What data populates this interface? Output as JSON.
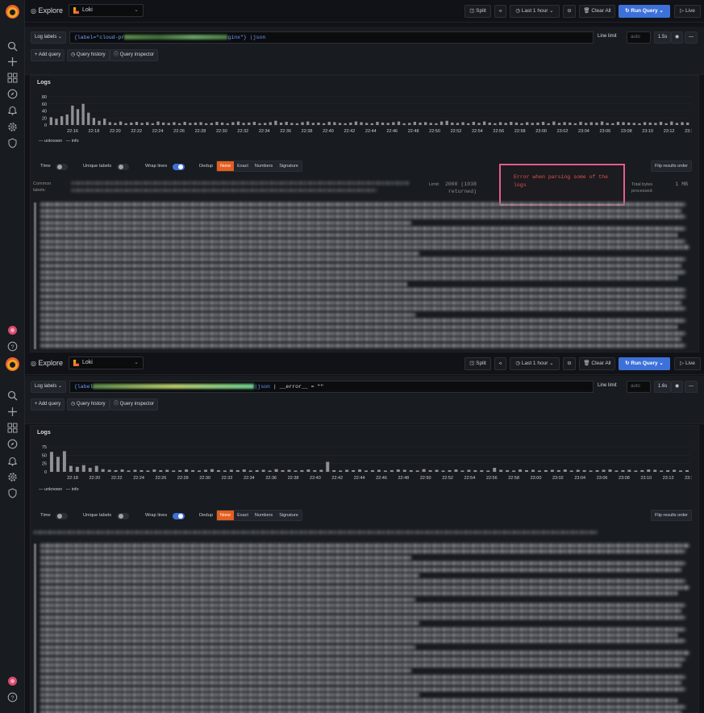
{
  "colors": {
    "accent": "#3d71d9",
    "error": "#e5534b",
    "highlight": "#e65c8d",
    "active": "#e65e1f",
    "bars": "#8e9095"
  },
  "sidebar": {
    "icons": [
      "grafana-logo-icon",
      "search-icon",
      "plus-icon",
      "dashboards-icon",
      "compass-icon",
      "bell-icon",
      "gear-icon",
      "shield-icon",
      "user-avatar-icon",
      "help-icon"
    ]
  },
  "header": {
    "title": "Explore",
    "datasource": "Loki",
    "split": "Split",
    "share_icon": "share-icon",
    "time_range": "Last 1 hour",
    "zoom_icon": "zoom-out-icon",
    "clear_all": "Clear All",
    "run_query": "Run Query",
    "live": "Live"
  },
  "query_row": {
    "log_labels": "Log labels",
    "line_limit": "Line limit",
    "line_limit_placeholder": "auto",
    "add_query": "Add query",
    "query_history": "Query history",
    "query_inspector": "Query inspector"
  },
  "screen1": {
    "query_pre": "{label=\"cloud-pr",
    "query_post": "ginx\"} ",
    "query_json": "|json",
    "duration": "1.5s",
    "panel_title": "Logs",
    "chart_data": {
      "type": "bar",
      "ylim": [
        0,
        80
      ],
      "yticks": [
        "80",
        "60",
        "40",
        "20",
        "0"
      ],
      "xticks": [
        "22:16",
        "22:18",
        "22:20",
        "22:22",
        "22:24",
        "22:26",
        "22:28",
        "22:30",
        "22:32",
        "22:34",
        "22:36",
        "22:38",
        "22:40",
        "22:42",
        "22:44",
        "22:46",
        "22:48",
        "22:50",
        "22:52",
        "22:54",
        "22:56",
        "22:58",
        "23:00",
        "23:02",
        "23:04",
        "23:06",
        "23:08",
        "23:10",
        "23:12",
        "23:14"
      ],
      "values": [
        22,
        18,
        25,
        30,
        55,
        45,
        60,
        35,
        20,
        12,
        18,
        8,
        6,
        10,
        5,
        7,
        9,
        6,
        8,
        5,
        10,
        7,
        6,
        8,
        5,
        9,
        6,
        7,
        8,
        5,
        6,
        9,
        7,
        5,
        8,
        10,
        6,
        7,
        9,
        5,
        6,
        8,
        12,
        7,
        9,
        6,
        5,
        8,
        10,
        6,
        7,
        5,
        9,
        8,
        6,
        5,
        7,
        10,
        8,
        6,
        5,
        9,
        7,
        6,
        8,
        10,
        5,
        6,
        9,
        7,
        8,
        6,
        5,
        10,
        12,
        7,
        6,
        8,
        5,
        9,
        6,
        10,
        7,
        5,
        8,
        6,
        9,
        7,
        5,
        8,
        6,
        7,
        9,
        5,
        10,
        6,
        8,
        7,
        5,
        9,
        6,
        8,
        7,
        10,
        6,
        5,
        9,
        8,
        7,
        6,
        5,
        8,
        7,
        6,
        9,
        5,
        10,
        6,
        8,
        7
      ]
    },
    "legend": [
      "unknown",
      "info"
    ],
    "controls": {
      "time": "Time",
      "unique_labels": "Unique labels",
      "wrap_lines": "Wrap lines",
      "dedup": "Dedup",
      "dedup_options": [
        "None",
        "Exact",
        "Numbers",
        "Signature"
      ],
      "flip": "Flip results order"
    },
    "common_labels": "Common labels:",
    "limit_label": "Limit:",
    "limit_value": "2000 (1038 returned)",
    "error_message": "Error when parsing some of the logs",
    "total_bytes_label": "Total bytes processed:",
    "total_bytes_value": "1 MB"
  },
  "screen2": {
    "query_pre": "{label",
    "query_json": "|json",
    "query_filter": " | __error__ = \"\"",
    "duration": "1.6s",
    "panel_title": "Logs",
    "chart_data": {
      "type": "bar",
      "ylim": [
        0,
        75
      ],
      "yticks": [
        "75",
        "50",
        "25",
        "0"
      ],
      "xticks": [
        "22:18",
        "22:20",
        "22:22",
        "22:24",
        "22:26",
        "22:28",
        "22:30",
        "22:32",
        "22:34",
        "22:36",
        "22:38",
        "22:40",
        "22:42",
        "22:44",
        "22:46",
        "22:48",
        "22:50",
        "22:52",
        "22:54",
        "22:56",
        "22:58",
        "23:00",
        "23:02",
        "23:04",
        "23:06",
        "23:08",
        "23:10",
        "23:12",
        "23:14"
      ],
      "values": [
        60,
        45,
        62,
        18,
        15,
        20,
        12,
        18,
        8,
        6,
        5,
        7,
        4,
        6,
        5,
        4,
        7,
        5,
        6,
        4,
        5,
        7,
        5,
        4,
        6,
        8,
        5,
        4,
        6,
        5,
        7,
        4,
        5,
        6,
        4,
        8,
        5,
        6,
        4,
        5,
        7,
        5,
        6,
        30,
        5,
        4,
        6,
        5,
        7,
        4,
        5,
        6,
        4,
        5,
        7,
        6,
        5,
        4,
        8,
        5,
        6,
        4,
        5,
        7,
        4,
        6,
        5,
        5,
        4,
        12,
        6,
        5,
        4,
        7,
        5,
        6,
        4,
        5,
        6,
        5,
        7,
        4,
        6,
        5,
        4,
        5,
        6,
        7,
        4,
        5,
        6,
        4,
        5,
        7,
        6,
        4,
        5,
        6,
        4,
        5
      ]
    },
    "legend": [
      "unknown",
      "info"
    ],
    "controls": {
      "time": "Time",
      "unique_labels": "Unique labels",
      "wrap_lines": "Wrap lines",
      "dedup": "Dedup",
      "dedup_options": [
        "None",
        "Exact",
        "Numbers",
        "Signature"
      ],
      "flip": "Flip results order"
    }
  }
}
